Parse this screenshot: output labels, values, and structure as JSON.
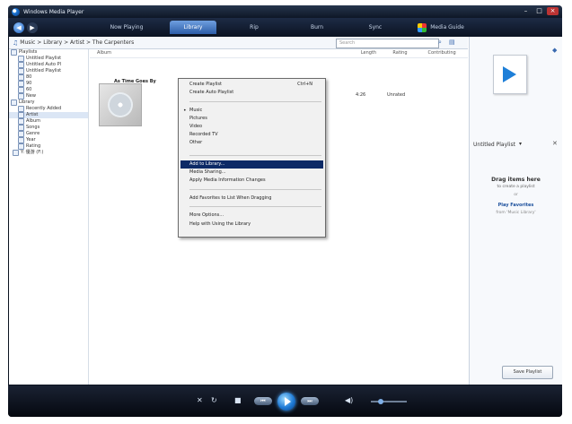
{
  "window": {
    "title": "Windows Media Player"
  },
  "tabs": [
    "Now Playing",
    "Library",
    "Rip",
    "Burn",
    "Sync",
    "Media Guide"
  ],
  "active_tab": "Library",
  "breadcrumb": "Music > Library > Artist > The Carpenters",
  "search_placeholder": "Search",
  "columns": [
    "Album",
    "",
    "",
    "",
    "",
    "Length",
    "Rating",
    "Contributing"
  ],
  "nav_tree": [
    "Playlists",
    "Untitled Playlist",
    "Untitled Auto Pl",
    "Untitled Playlist",
    "80",
    "90",
    "60",
    "New",
    "Library",
    "Recently Added",
    "Artist",
    "Album",
    "Songs",
    "Genre",
    "Year",
    "Rating",
    "Y: 優游 (F:)"
  ],
  "album": {
    "title": "As Time Goes By"
  },
  "track": {
    "length": "4:26",
    "rating": "Unrated"
  },
  "library_menu": {
    "items": [
      {
        "label": "Create Playlist",
        "shortcut": "Ctrl+N"
      },
      {
        "label": "Create Auto Playlist"
      },
      {
        "label": "Music",
        "bullet": true
      },
      {
        "label": "Pictures"
      },
      {
        "label": "Video"
      },
      {
        "label": "Recorded TV"
      },
      {
        "label": "Other"
      },
      {
        "label": "Add to Library...",
        "highlighted": true
      },
      {
        "label": "Media Sharing..."
      },
      {
        "label": "Apply Media Information Changes"
      },
      {
        "label": "Add Favorites to List When Dragging"
      },
      {
        "label": "More Options..."
      },
      {
        "label": "Help with Using the Library"
      }
    ]
  },
  "list_pane": {
    "name": "Untitled Playlist",
    "drag_main": "Drag items here",
    "drag_sub": "to create a playlist",
    "or_text": "or",
    "link": "Play Favorites",
    "link_sub": "from 'Music Library'",
    "save_button": "Save Playlist"
  },
  "icons": {
    "media-player": "wmp-orb",
    "back": "back-arrow-icon",
    "forward": "forward-arrow-icon",
    "play": "play-icon"
  },
  "colors": {
    "menu_highlight": "#0d2a66",
    "accent": "#1e7fd8"
  }
}
